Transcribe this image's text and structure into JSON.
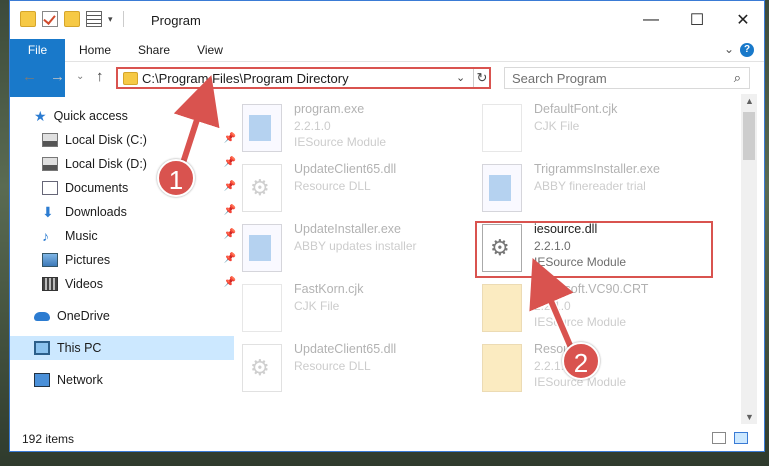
{
  "window": {
    "title": "Program",
    "min_glyph": "—",
    "max_glyph": "☐",
    "close_glyph": "✕"
  },
  "ribbon": {
    "tabs": [
      "File",
      "Home",
      "Share",
      "View"
    ],
    "chevron": "⌄",
    "help": "?"
  },
  "nav": {
    "back": "←",
    "forward": "→",
    "recent": "⌄",
    "up": "↑",
    "address": "C:\\Program Files\\Program Directory",
    "dropdown": "⌄",
    "refresh": "↻",
    "search_placeholder": "Search Program",
    "search_icon": "⌕"
  },
  "sidebar": {
    "items": [
      {
        "label": "Quick access",
        "icon": "star-icon"
      },
      {
        "label": "Local Disk (C:)",
        "icon": "drive-icon",
        "pin": "📌"
      },
      {
        "label": "Local Disk (D:)",
        "icon": "drive-icon",
        "pin": "📌"
      },
      {
        "label": "Documents",
        "icon": "document-icon",
        "pin": "📌"
      },
      {
        "label": "Downloads",
        "icon": "download-icon",
        "pin": "📌"
      },
      {
        "label": "Music",
        "icon": "music-icon",
        "pin": "📌"
      },
      {
        "label": "Pictures",
        "icon": "pictures-icon",
        "pin": "📌"
      },
      {
        "label": "Videos",
        "icon": "videos-icon",
        "pin": "📌"
      },
      {
        "label": "OneDrive",
        "icon": "cloud-icon"
      },
      {
        "label": "This PC",
        "icon": "computer-icon",
        "selected": true
      },
      {
        "label": "Network",
        "icon": "network-icon"
      }
    ]
  },
  "files": [
    {
      "name": "program.exe",
      "line2": "2.2.1.0",
      "line3": "IESource Module",
      "icon": "exe-icon",
      "faded": true
    },
    {
      "name": "DefaultFont.cjk",
      "line2": "CJK File",
      "line3": "",
      "icon": "blank-file-icon",
      "faded": true
    },
    {
      "name": "UpdateClient65.dll",
      "line2": "Resource DLL",
      "line3": "",
      "icon": "dll-gear-icon",
      "faded": true
    },
    {
      "name": "TrigrammsInstaller.exe",
      "line2": "ABBY finereader trial",
      "line3": "",
      "icon": "installer-icon",
      "faded": true
    },
    {
      "name": "UpdateInstaller.exe",
      "line2": "ABBY updates installer",
      "line3": "",
      "icon": "installer-icon",
      "faded": true
    },
    {
      "name": "iesource.dll",
      "line2": "2.2.1.0",
      "line3": "IESource Module",
      "icon": "dll-gear-icon",
      "faded": false
    },
    {
      "name": "FastKorn.cjk",
      "line2": "CJK File",
      "line3": "",
      "icon": "blank-file-icon",
      "faded": true
    },
    {
      "name": "Microsoft.VC90.CRT",
      "line2": "2.2.1.0",
      "line3": "IESource Module",
      "icon": "zip-folder-icon",
      "faded": true
    },
    {
      "name": "UpdateClient65.dll",
      "line2": "Resource DLL",
      "line3": "",
      "icon": "dll-gear-icon",
      "faded": true
    },
    {
      "name": "Resources",
      "line2": "2.2.1.0",
      "line3": "IESource Module",
      "icon": "zip-folder-icon",
      "faded": true
    }
  ],
  "status": {
    "count": "192 items"
  },
  "annotations": {
    "callout_1": "1",
    "callout_2": "2",
    "color": "#d9534f"
  },
  "colors": {
    "accent": "#1979ca",
    "selection": "#cce8ff",
    "highlight_border": "#d9534f"
  }
}
